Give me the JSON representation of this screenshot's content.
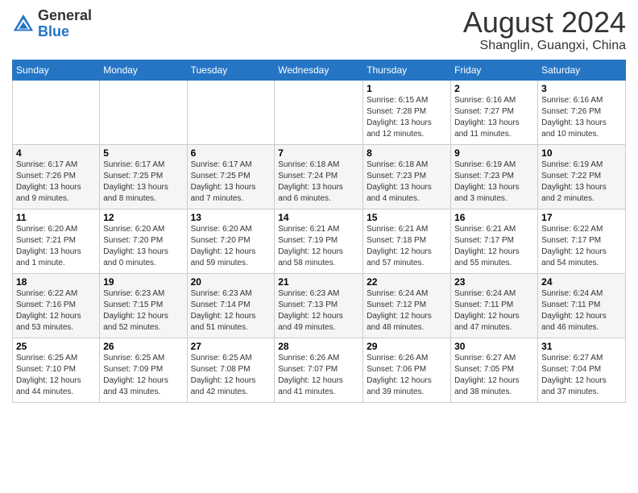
{
  "header": {
    "logo_general": "General",
    "logo_blue": "Blue",
    "month_title": "August 2024",
    "location": "Shanglin, Guangxi, China"
  },
  "weekdays": [
    "Sunday",
    "Monday",
    "Tuesday",
    "Wednesday",
    "Thursday",
    "Friday",
    "Saturday"
  ],
  "weeks": [
    [
      {
        "day": "",
        "info": ""
      },
      {
        "day": "",
        "info": ""
      },
      {
        "day": "",
        "info": ""
      },
      {
        "day": "",
        "info": ""
      },
      {
        "day": "1",
        "info": "Sunrise: 6:15 AM\nSunset: 7:28 PM\nDaylight: 13 hours\nand 12 minutes."
      },
      {
        "day": "2",
        "info": "Sunrise: 6:16 AM\nSunset: 7:27 PM\nDaylight: 13 hours\nand 11 minutes."
      },
      {
        "day": "3",
        "info": "Sunrise: 6:16 AM\nSunset: 7:26 PM\nDaylight: 13 hours\nand 10 minutes."
      }
    ],
    [
      {
        "day": "4",
        "info": "Sunrise: 6:17 AM\nSunset: 7:26 PM\nDaylight: 13 hours\nand 9 minutes."
      },
      {
        "day": "5",
        "info": "Sunrise: 6:17 AM\nSunset: 7:25 PM\nDaylight: 13 hours\nand 8 minutes."
      },
      {
        "day": "6",
        "info": "Sunrise: 6:17 AM\nSunset: 7:25 PM\nDaylight: 13 hours\nand 7 minutes."
      },
      {
        "day": "7",
        "info": "Sunrise: 6:18 AM\nSunset: 7:24 PM\nDaylight: 13 hours\nand 6 minutes."
      },
      {
        "day": "8",
        "info": "Sunrise: 6:18 AM\nSunset: 7:23 PM\nDaylight: 13 hours\nand 4 minutes."
      },
      {
        "day": "9",
        "info": "Sunrise: 6:19 AM\nSunset: 7:23 PM\nDaylight: 13 hours\nand 3 minutes."
      },
      {
        "day": "10",
        "info": "Sunrise: 6:19 AM\nSunset: 7:22 PM\nDaylight: 13 hours\nand 2 minutes."
      }
    ],
    [
      {
        "day": "11",
        "info": "Sunrise: 6:20 AM\nSunset: 7:21 PM\nDaylight: 13 hours\nand 1 minute."
      },
      {
        "day": "12",
        "info": "Sunrise: 6:20 AM\nSunset: 7:20 PM\nDaylight: 13 hours\nand 0 minutes."
      },
      {
        "day": "13",
        "info": "Sunrise: 6:20 AM\nSunset: 7:20 PM\nDaylight: 12 hours\nand 59 minutes."
      },
      {
        "day": "14",
        "info": "Sunrise: 6:21 AM\nSunset: 7:19 PM\nDaylight: 12 hours\nand 58 minutes."
      },
      {
        "day": "15",
        "info": "Sunrise: 6:21 AM\nSunset: 7:18 PM\nDaylight: 12 hours\nand 57 minutes."
      },
      {
        "day": "16",
        "info": "Sunrise: 6:21 AM\nSunset: 7:17 PM\nDaylight: 12 hours\nand 55 minutes."
      },
      {
        "day": "17",
        "info": "Sunrise: 6:22 AM\nSunset: 7:17 PM\nDaylight: 12 hours\nand 54 minutes."
      }
    ],
    [
      {
        "day": "18",
        "info": "Sunrise: 6:22 AM\nSunset: 7:16 PM\nDaylight: 12 hours\nand 53 minutes."
      },
      {
        "day": "19",
        "info": "Sunrise: 6:23 AM\nSunset: 7:15 PM\nDaylight: 12 hours\nand 52 minutes."
      },
      {
        "day": "20",
        "info": "Sunrise: 6:23 AM\nSunset: 7:14 PM\nDaylight: 12 hours\nand 51 minutes."
      },
      {
        "day": "21",
        "info": "Sunrise: 6:23 AM\nSunset: 7:13 PM\nDaylight: 12 hours\nand 49 minutes."
      },
      {
        "day": "22",
        "info": "Sunrise: 6:24 AM\nSunset: 7:12 PM\nDaylight: 12 hours\nand 48 minutes."
      },
      {
        "day": "23",
        "info": "Sunrise: 6:24 AM\nSunset: 7:11 PM\nDaylight: 12 hours\nand 47 minutes."
      },
      {
        "day": "24",
        "info": "Sunrise: 6:24 AM\nSunset: 7:11 PM\nDaylight: 12 hours\nand 46 minutes."
      }
    ],
    [
      {
        "day": "25",
        "info": "Sunrise: 6:25 AM\nSunset: 7:10 PM\nDaylight: 12 hours\nand 44 minutes."
      },
      {
        "day": "26",
        "info": "Sunrise: 6:25 AM\nSunset: 7:09 PM\nDaylight: 12 hours\nand 43 minutes."
      },
      {
        "day": "27",
        "info": "Sunrise: 6:25 AM\nSunset: 7:08 PM\nDaylight: 12 hours\nand 42 minutes."
      },
      {
        "day": "28",
        "info": "Sunrise: 6:26 AM\nSunset: 7:07 PM\nDaylight: 12 hours\nand 41 minutes."
      },
      {
        "day": "29",
        "info": "Sunrise: 6:26 AM\nSunset: 7:06 PM\nDaylight: 12 hours\nand 39 minutes."
      },
      {
        "day": "30",
        "info": "Sunrise: 6:27 AM\nSunset: 7:05 PM\nDaylight: 12 hours\nand 38 minutes."
      },
      {
        "day": "31",
        "info": "Sunrise: 6:27 AM\nSunset: 7:04 PM\nDaylight: 12 hours\nand 37 minutes."
      }
    ]
  ]
}
